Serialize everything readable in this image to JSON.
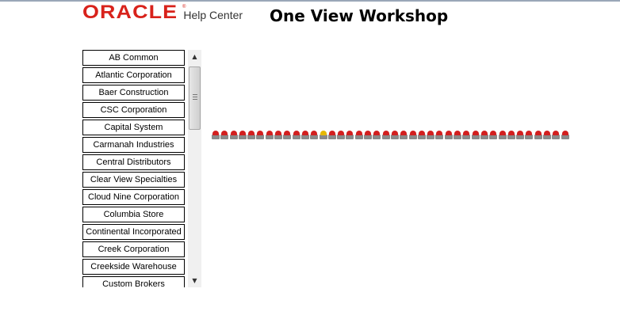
{
  "header": {
    "logo_text": "ORACLE",
    "logo_mark": "®",
    "help_center": "Help Center",
    "page_title": "One View Workshop"
  },
  "company_list": {
    "items": [
      "AB Common",
      "Atlantic Corporation",
      "Baer Construction",
      "CSC Corporation",
      "Capital System",
      "Carmanah Industries",
      "Central Distributors",
      "Clear View Specialties",
      "Cloud Nine Corporation",
      "Columbia Store",
      "Continental Incorporated",
      "Creek Corporation",
      "Creekside Warehouse",
      "Custom Brokers"
    ]
  },
  "scrollbar": {
    "up_icon": "arrow-up-icon",
    "down_icon": "arrow-down-icon",
    "position_fraction": 0.0
  },
  "loading_strip": {
    "icon": "loading-indicator-icon",
    "count": 40,
    "highlight_index": 12,
    "colors": {
      "cap": "#d21f1f",
      "highlight": "#e6b800",
      "base": "#8a8a8a"
    }
  },
  "colors": {
    "brand": "#d8221b",
    "border": "#000000"
  }
}
